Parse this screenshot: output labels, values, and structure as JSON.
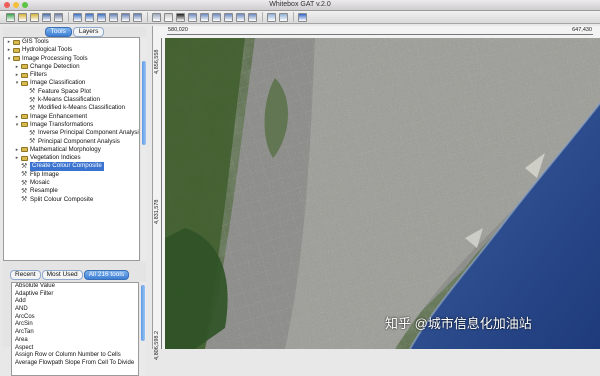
{
  "window": {
    "title": "Whitebox GAT v.2.0",
    "traffic_lights": [
      "#ee5f59",
      "#f4bf3b",
      "#5dc443"
    ]
  },
  "toolbar": {
    "buttons": [
      {
        "name": "open-icon",
        "color": "#3aa34a"
      },
      {
        "name": "folder-open-icon",
        "color": "#d6b23a"
      },
      {
        "name": "folder-icon",
        "color": "#d6b23a"
      },
      {
        "name": "save-icon",
        "color": "#4c6fb0"
      },
      {
        "name": "print-icon",
        "color": "#6f7fa4"
      },
      {
        "name": "sep"
      },
      {
        "name": "layer-icon",
        "color": "#3d72c6"
      },
      {
        "name": "layer-add-icon",
        "color": "#3d72c6"
      },
      {
        "name": "layer-remove-icon",
        "color": "#3d72c6"
      },
      {
        "name": "layers-icon",
        "color": "#6680b8"
      },
      {
        "name": "layers-down-icon",
        "color": "#6680b8"
      },
      {
        "name": "layers-up-icon",
        "color": "#6680b8"
      },
      {
        "name": "sep"
      },
      {
        "name": "zoom-extent-icon",
        "color": "#9aa7bd"
      },
      {
        "name": "pan-hand-icon",
        "color": "#c8c8c8"
      },
      {
        "name": "pointer-icon",
        "color": "#222222"
      },
      {
        "name": "zoom-in-icon",
        "color": "#6d8bc2"
      },
      {
        "name": "zoom-out-icon",
        "color": "#6d8bc2"
      },
      {
        "name": "zoom-layer-icon",
        "color": "#6d8bc2"
      },
      {
        "name": "zoom-full-icon",
        "color": "#6d8bc2"
      },
      {
        "name": "previous-extent-icon",
        "color": "#6d8bc2"
      },
      {
        "name": "next-extent-icon",
        "color": "#6d8bc2"
      },
      {
        "name": "sep"
      },
      {
        "name": "select-feature-icon",
        "color": "#8fb0d6"
      },
      {
        "name": "refresh-icon",
        "color": "#8fb0d6"
      },
      {
        "name": "sep"
      },
      {
        "name": "help-icon",
        "color": "#3566c9"
      }
    ]
  },
  "left_panel": {
    "tabs": [
      {
        "label": "Tools",
        "active": true
      },
      {
        "label": "Layers",
        "active": false
      }
    ],
    "tree": [
      {
        "label": "GIS Tools",
        "level": 1,
        "type": "folder",
        "twisty": "▸"
      },
      {
        "label": "Hydrological Tools",
        "level": 1,
        "type": "folder",
        "twisty": "▸"
      },
      {
        "label": "Image Processing Tools",
        "level": 1,
        "type": "folder",
        "twisty": "▾"
      },
      {
        "label": "Change Detection",
        "level": 2,
        "type": "folder",
        "twisty": "▸"
      },
      {
        "label": "Filters",
        "level": 2,
        "type": "folder",
        "twisty": "▸"
      },
      {
        "label": "Image Classification",
        "level": 2,
        "type": "folder",
        "twisty": "▾"
      },
      {
        "label": "Feature Space Plot",
        "level": 3,
        "type": "tool"
      },
      {
        "label": "k-Means Classification",
        "level": 3,
        "type": "tool"
      },
      {
        "label": "Modified k-Means Classification",
        "level": 3,
        "type": "tool"
      },
      {
        "label": "Image Enhancement",
        "level": 2,
        "type": "folder",
        "twisty": "▸"
      },
      {
        "label": "Image Transformations",
        "level": 2,
        "type": "folder",
        "twisty": "▾"
      },
      {
        "label": "Inverse Principal Component Analysis",
        "level": 3,
        "type": "tool"
      },
      {
        "label": "Principal Component Analysis",
        "level": 3,
        "type": "tool"
      },
      {
        "label": "Mathematical Morphology",
        "level": 2,
        "type": "folder",
        "twisty": "▸"
      },
      {
        "label": "Vegetation Indices",
        "level": 2,
        "type": "folder",
        "twisty": "▸"
      },
      {
        "label": "Create Colour Composite",
        "level": 2,
        "type": "tool",
        "selected": true
      },
      {
        "label": "Flip Image",
        "level": 2,
        "type": "tool"
      },
      {
        "label": "Mosaic",
        "level": 2,
        "type": "tool"
      },
      {
        "label": "Resample",
        "level": 2,
        "type": "tool"
      },
      {
        "label": "Split Colour Composite",
        "level": 2,
        "type": "tool"
      }
    ],
    "bottom_tabs": [
      {
        "label": "Recent",
        "active": false
      },
      {
        "label": "Most Used",
        "active": false
      },
      {
        "label": "All 216 tools",
        "active": true
      }
    ],
    "tool_list": [
      "Absolute Value",
      "Adaptive Filter",
      "Add",
      "AND",
      "ArcCos",
      "ArcSin",
      "ArcTan",
      "Area",
      "Aspect",
      "Assign Row or Column Number to Cells",
      "Average Flowpath Slope From Cell To Divide"
    ]
  },
  "map": {
    "x_min_label": "580,020",
    "x_max_label": "647,430",
    "y_max_label": "4,856,558",
    "y_mid_label": "4,831,578",
    "y_min_label": "4,806,598.2"
  },
  "watermark": "知乎 @城市信息化加油站"
}
